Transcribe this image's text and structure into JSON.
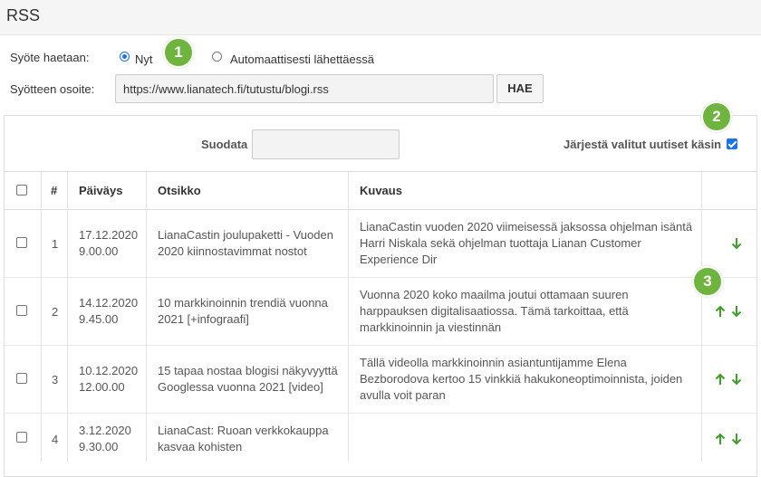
{
  "header": {
    "title": "RSS"
  },
  "fetch": {
    "label": "Syöte haetaan:",
    "options": [
      {
        "label": "Nyt",
        "checked": true
      },
      {
        "label": "Automaattisesti lähettäessä",
        "checked": false
      }
    ]
  },
  "feed": {
    "label": "Syötteen osoite:",
    "url": "https://www.lianatech.fi/tutustu/blogi.rss",
    "button": "HAE"
  },
  "filter": {
    "label": "Suodata",
    "value": ""
  },
  "sort": {
    "label": "Järjestä valitut uutiset käsin",
    "checked": true
  },
  "badges": [
    "1",
    "2",
    "3"
  ],
  "table": {
    "headers": {
      "num": "#",
      "date": "Päiväys",
      "title": "Otsikko",
      "desc": "Kuvaus"
    },
    "rows": [
      {
        "num": "1",
        "date": "17.12.2020",
        "time": "9.00.00",
        "title1": "LianaCastin joulupaketti - Vuoden",
        "title2": "2020 kiinnostavimmat nostot",
        "desc1": "LianaCastin vuoden 2020 viimeisessä jaksossa ohjelman isäntä",
        "desc2": "Harri Niskala sekä ohjelman tuottaja Lianan Customer",
        "desc3": "Experience Dir",
        "up": false,
        "down": true
      },
      {
        "num": "2",
        "date": "14.12.2020",
        "time": "9.45.00",
        "title1": "10 markkinoinnin trendiä vuonna",
        "title2": "2021 [+infograafi]",
        "desc1": "Vuonna 2020 koko maailma joutui ottamaan suuren",
        "desc2": "harppauksen digitalisaatiossa. Tämä tarkoittaa, että",
        "desc3": "markkinoinnin ja viestinnän",
        "up": true,
        "down": true
      },
      {
        "num": "3",
        "date": "10.12.2020",
        "time": "12.00.00",
        "title1": "15 tapaa nostaa blogisi näkyvyyttä",
        "title2": "Googlessa vuonna 2021 [video]",
        "desc1": "Tällä videolla markkinoinnin asiantuntijamme Elena",
        "desc2": "Bezborodova kertoo 15 vinkkiä hakukoneoptimoinnista, joiden",
        "desc3": "avulla voit paran",
        "up": true,
        "down": true
      },
      {
        "num": "4",
        "date": "3.12.2020",
        "time": "9.30.00",
        "title1": "LianaCast: Ruoan verkkokauppa",
        "title2": "kasvaa kohisten",
        "desc1": "",
        "desc2": "",
        "desc3": "",
        "up": true,
        "down": true
      }
    ]
  },
  "colors": {
    "accent": "#6eb43f",
    "arrow": "#3f9f2a",
    "radio": "#1a73e8"
  }
}
